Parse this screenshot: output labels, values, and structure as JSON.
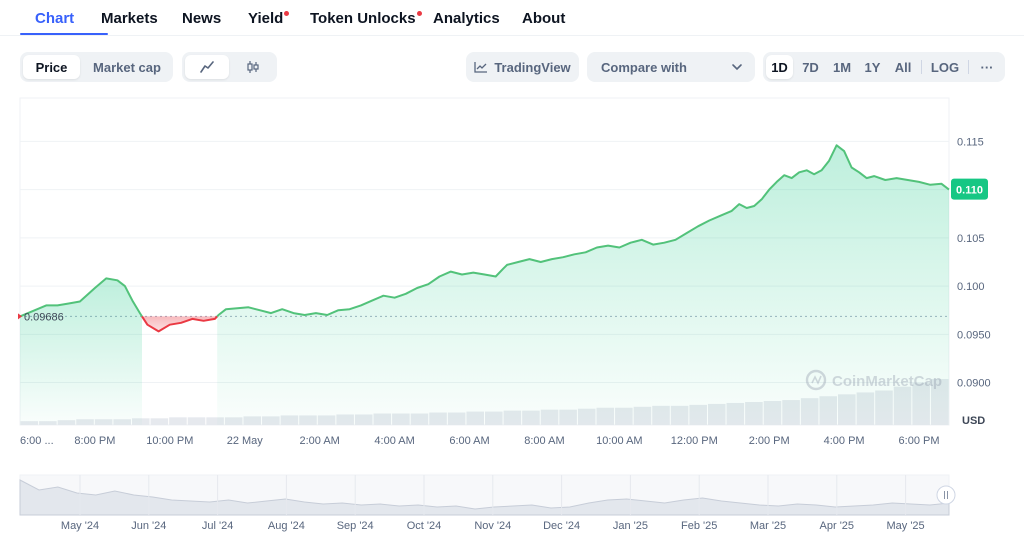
{
  "tabs": [
    {
      "label": "Chart",
      "active": true,
      "dot": false
    },
    {
      "label": "Markets",
      "active": false,
      "dot": false
    },
    {
      "label": "News",
      "active": false,
      "dot": false
    },
    {
      "label": "Yield",
      "active": false,
      "dot": true
    },
    {
      "label": "Token Unlocks",
      "active": false,
      "dot": true
    },
    {
      "label": "Analytics",
      "active": false,
      "dot": false
    },
    {
      "label": "About",
      "active": false,
      "dot": false
    }
  ],
  "toolbar": {
    "price_label": "Price",
    "marketcap_label": "Market cap",
    "line_icon": "line-chart-icon",
    "candle_icon": "candlestick-icon",
    "tradingview_label": "TradingView",
    "compare_label": "Compare with",
    "ranges": [
      "1D",
      "7D",
      "1M",
      "1Y",
      "All",
      "LOG"
    ],
    "active_range": "1D",
    "more_label": "···"
  },
  "colors": {
    "up": "#16c784",
    "up_line": "#52c27a",
    "down": "#ea3943",
    "accent": "#3861fb",
    "grid": "#eff2f5",
    "muted": "#58667e"
  },
  "watermark": "CoinMarketCap",
  "chart_data": {
    "type": "area",
    "currency_label": "USD",
    "baseline_label": "0.09686",
    "baseline": 0.09686,
    "current_label": "0.110",
    "ylim": [
      0.0856,
      0.1195
    ],
    "yticks": [
      {
        "value": 0.115,
        "label": "0.115"
      },
      {
        "value": 0.11,
        "label": "0.110"
      },
      {
        "value": 0.105,
        "label": "0.105"
      },
      {
        "value": 0.1,
        "label": "0.100"
      },
      {
        "value": 0.095,
        "label": "0.0950"
      },
      {
        "value": 0.09,
        "label": "0.0900"
      }
    ],
    "xlim": [
      18.0,
      42.8
    ],
    "xticks": [
      {
        "value": 18.0,
        "label": "6:00 ..."
      },
      {
        "value": 20.0,
        "label": "8:00 PM"
      },
      {
        "value": 22.0,
        "label": "10:00 PM"
      },
      {
        "value": 24.0,
        "label": "22 May"
      },
      {
        "value": 26.0,
        "label": "2:00 AM"
      },
      {
        "value": 28.0,
        "label": "4:00 AM"
      },
      {
        "value": 30.0,
        "label": "6:00 AM"
      },
      {
        "value": 32.0,
        "label": "8:00 AM"
      },
      {
        "value": 34.0,
        "label": "10:00 AM"
      },
      {
        "value": 36.0,
        "label": "12:00 PM"
      },
      {
        "value": 38.0,
        "label": "2:00 PM"
      },
      {
        "value": 40.0,
        "label": "4:00 PM"
      },
      {
        "value": 42.0,
        "label": "6:00 PM"
      }
    ],
    "series": [
      {
        "points": [
          [
            18.0,
            0.09686
          ],
          [
            18.7,
            0.098
          ],
          [
            19.0,
            0.098
          ],
          [
            19.3,
            0.0982
          ],
          [
            19.6,
            0.0984
          ],
          [
            20.0,
            0.0998
          ],
          [
            20.3,
            0.1008
          ],
          [
            20.6,
            0.1006
          ],
          [
            20.8,
            0.1
          ],
          [
            21.0,
            0.0985
          ],
          [
            21.2,
            0.0972
          ],
          [
            21.4,
            0.096
          ],
          [
            21.7,
            0.0953
          ],
          [
            22.0,
            0.096
          ],
          [
            22.3,
            0.0962
          ],
          [
            22.6,
            0.0966
          ],
          [
            22.9,
            0.0964
          ],
          [
            23.2,
            0.0966
          ],
          [
            23.3,
            0.097
          ],
          [
            23.5,
            0.0976
          ],
          [
            23.8,
            0.0977
          ],
          [
            24.1,
            0.0978
          ],
          [
            24.4,
            0.0975
          ],
          [
            24.7,
            0.0972
          ],
          [
            25.0,
            0.0976
          ],
          [
            25.3,
            0.0972
          ],
          [
            25.6,
            0.097
          ],
          [
            25.9,
            0.0972
          ],
          [
            26.2,
            0.097
          ],
          [
            26.5,
            0.0975
          ],
          [
            26.8,
            0.0976
          ],
          [
            27.1,
            0.098
          ],
          [
            27.4,
            0.0985
          ],
          [
            27.7,
            0.099
          ],
          [
            28.0,
            0.0988
          ],
          [
            28.3,
            0.0992
          ],
          [
            28.6,
            0.0998
          ],
          [
            28.9,
            0.1002
          ],
          [
            29.2,
            0.101
          ],
          [
            29.5,
            0.1015
          ],
          [
            29.8,
            0.1012
          ],
          [
            30.1,
            0.1014
          ],
          [
            30.4,
            0.1012
          ],
          [
            30.7,
            0.101
          ],
          [
            30.9,
            0.1018
          ],
          [
            31.0,
            0.1022
          ],
          [
            31.3,
            0.1025
          ],
          [
            31.6,
            0.1028
          ],
          [
            31.9,
            0.1025
          ],
          [
            32.2,
            0.1028
          ],
          [
            32.5,
            0.103
          ],
          [
            32.8,
            0.1033
          ],
          [
            33.1,
            0.1035
          ],
          [
            33.4,
            0.104
          ],
          [
            33.7,
            0.1042
          ],
          [
            34.0,
            0.104
          ],
          [
            34.3,
            0.1045
          ],
          [
            34.6,
            0.1048
          ],
          [
            34.9,
            0.1043
          ],
          [
            35.2,
            0.1045
          ],
          [
            35.5,
            0.1048
          ],
          [
            35.8,
            0.1055
          ],
          [
            36.1,
            0.1062
          ],
          [
            36.4,
            0.1068
          ],
          [
            36.7,
            0.1073
          ],
          [
            37.0,
            0.1078
          ],
          [
            37.2,
            0.1085
          ],
          [
            37.4,
            0.1081
          ],
          [
            37.6,
            0.1083
          ],
          [
            37.8,
            0.109
          ],
          [
            38.0,
            0.11
          ],
          [
            38.2,
            0.1108
          ],
          [
            38.4,
            0.1115
          ],
          [
            38.6,
            0.1112
          ],
          [
            38.8,
            0.1118
          ],
          [
            39.0,
            0.112
          ],
          [
            39.2,
            0.1116
          ],
          [
            39.4,
            0.112
          ],
          [
            39.6,
            0.113
          ],
          [
            39.8,
            0.1146
          ],
          [
            40.0,
            0.114
          ],
          [
            40.2,
            0.1123
          ],
          [
            40.4,
            0.1118
          ],
          [
            40.6,
            0.1112
          ],
          [
            40.8,
            0.1114
          ],
          [
            41.1,
            0.111
          ],
          [
            41.4,
            0.1112
          ],
          [
            41.7,
            0.111
          ],
          [
            42.0,
            0.1108
          ],
          [
            42.3,
            0.1105
          ],
          [
            42.6,
            0.1106
          ],
          [
            42.8,
            0.11
          ]
        ]
      }
    ],
    "volume": [
      2,
      2,
      2.5,
      3,
      3,
      3,
      3.5,
      3.5,
      4,
      4,
      4,
      4,
      4.5,
      4.5,
      5,
      5,
      5,
      5.5,
      5.5,
      6,
      6,
      6,
      6.5,
      6.5,
      7,
      7,
      7.5,
      7.5,
      8,
      8,
      8.5,
      9,
      9,
      9.5,
      10,
      10,
      10.5,
      11,
      11.5,
      12,
      12.5,
      13,
      14,
      15,
      16,
      17,
      18,
      20,
      22,
      24
    ],
    "navigator": {
      "xticks": [
        "May '24",
        "Jun '24",
        "Jul '24",
        "Aug '24",
        "Sep '24",
        "Oct '24",
        "Nov '24",
        "Dec '24",
        "Jan '25",
        "Feb '25",
        "Mar '25",
        "Apr '25",
        "May '25"
      ],
      "values": [
        0.105,
        0.095,
        0.098,
        0.092,
        0.09,
        0.094,
        0.09,
        0.088,
        0.085,
        0.084,
        0.083,
        0.085,
        0.082,
        0.084,
        0.086,
        0.083,
        0.081,
        0.082,
        0.08,
        0.081,
        0.079,
        0.08,
        0.078,
        0.079,
        0.076,
        0.078,
        0.079,
        0.08,
        0.077,
        0.078,
        0.082,
        0.085,
        0.086,
        0.084,
        0.082,
        0.085,
        0.087,
        0.084,
        0.082,
        0.08,
        0.079,
        0.081,
        0.08,
        0.078,
        0.079,
        0.08,
        0.082,
        0.081,
        0.08,
        0.082
      ]
    }
  }
}
